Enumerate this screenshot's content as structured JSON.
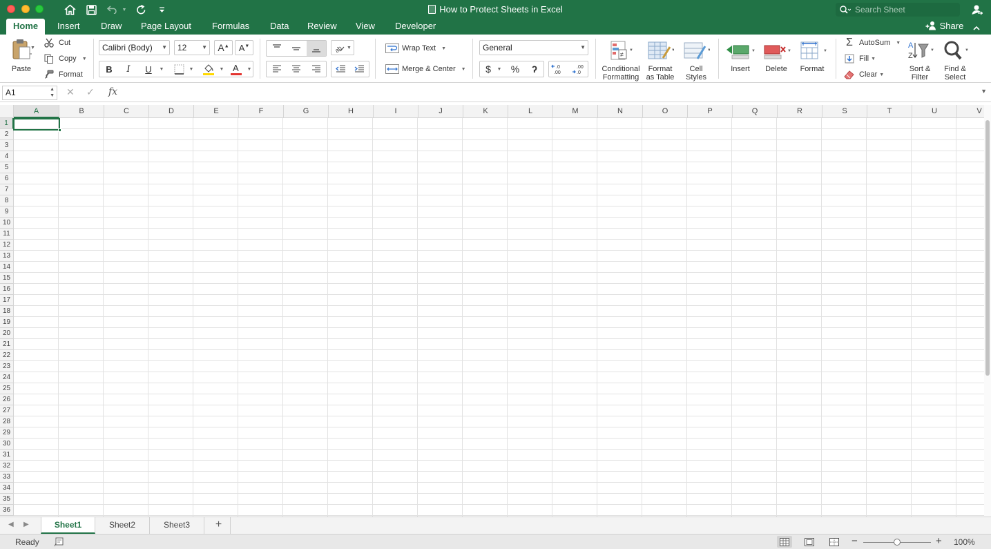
{
  "window": {
    "title": "How to Protect Sheets in Excel"
  },
  "search": {
    "placeholder": "Search Sheet"
  },
  "tabs": [
    {
      "label": "Home",
      "active": true
    },
    {
      "label": "Insert"
    },
    {
      "label": "Draw"
    },
    {
      "label": "Page Layout"
    },
    {
      "label": "Formulas"
    },
    {
      "label": "Data"
    },
    {
      "label": "Review"
    },
    {
      "label": "View"
    },
    {
      "label": "Developer"
    }
  ],
  "share_label": "Share",
  "ribbon": {
    "paste": "Paste",
    "cut": "Cut",
    "copy": "Copy",
    "format_painter": "Format",
    "font_name": "Calibri (Body)",
    "font_size": "12",
    "bold": "B",
    "italic": "I",
    "underline": "U",
    "wrap_text": "Wrap Text",
    "merge_center": "Merge & Center",
    "number_format": "General",
    "currency": "$",
    "percent": "%",
    "comma": "ʔ",
    "conditional_formatting_1": "Conditional",
    "conditional_formatting_2": "Formatting",
    "format_as_table_1": "Format",
    "format_as_table_2": "as Table",
    "cell_styles_1": "Cell",
    "cell_styles_2": "Styles",
    "insert": "Insert",
    "delete": "Delete",
    "format": "Format",
    "autosum": "AutoSum",
    "fill": "Fill",
    "clear": "Clear",
    "sort_filter_1": "Sort &",
    "sort_filter_2": "Filter",
    "find_select_1": "Find &",
    "find_select_2": "Select"
  },
  "formula_bar": {
    "name_box": "A1",
    "fx": "fx",
    "value": ""
  },
  "grid": {
    "columns": [
      "A",
      "B",
      "C",
      "D",
      "E",
      "F",
      "G",
      "H",
      "I",
      "J",
      "K",
      "L",
      "M",
      "N",
      "O",
      "P",
      "Q",
      "R",
      "S",
      "T",
      "U",
      "V"
    ],
    "rows": [
      "1",
      "2",
      "3",
      "4",
      "5",
      "6",
      "7",
      "8",
      "9",
      "10",
      "11",
      "12",
      "13",
      "14",
      "15",
      "16",
      "17",
      "18",
      "19",
      "20",
      "21",
      "22",
      "23",
      "24",
      "25",
      "26",
      "27",
      "28",
      "29",
      "30",
      "31",
      "32",
      "33",
      "34",
      "35",
      "36"
    ],
    "selected_column": "A",
    "selected_row": "1"
  },
  "sheets": [
    {
      "label": "Sheet1",
      "active": true
    },
    {
      "label": "Sheet2"
    },
    {
      "label": "Sheet3"
    }
  ],
  "add_sheet": "+",
  "status": {
    "ready": "Ready",
    "zoom": "100%",
    "zoom_minus": "−",
    "zoom_plus": "+"
  },
  "colors": {
    "brand": "#217346",
    "accent_red": "#e3342f",
    "fill_yellow": "#ffd800"
  }
}
